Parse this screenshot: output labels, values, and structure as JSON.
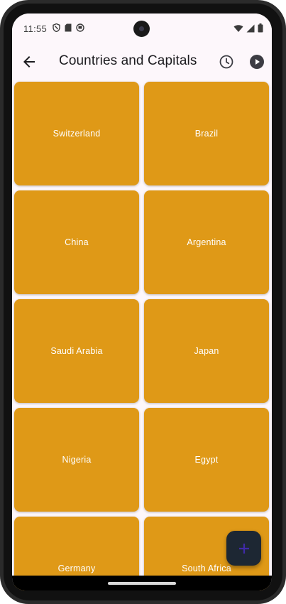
{
  "status_bar": {
    "time": "11:55",
    "icons_left": [
      "shield-icon",
      "sd-card-icon",
      "app-notification-icon"
    ],
    "icons_right": [
      "wifi-icon",
      "signal-icon",
      "battery-icon"
    ]
  },
  "app_bar": {
    "title": "Countries and Capitals",
    "back_icon": "arrow-back-icon",
    "actions": [
      "history-icon",
      "play-circle-icon"
    ]
  },
  "grid": {
    "card_color": "#df9917",
    "items": [
      {
        "label": "Switzerland"
      },
      {
        "label": "Brazil"
      },
      {
        "label": "China"
      },
      {
        "label": "Argentina"
      },
      {
        "label": "Saudi Arabia"
      },
      {
        "label": "Japan"
      },
      {
        "label": "Nigeria"
      },
      {
        "label": "Egypt"
      },
      {
        "label": "Germany"
      },
      {
        "label": "South Africa"
      }
    ]
  },
  "fab": {
    "icon": "add-icon",
    "color": "#1d2733",
    "icon_color": "#3f2aa8"
  }
}
